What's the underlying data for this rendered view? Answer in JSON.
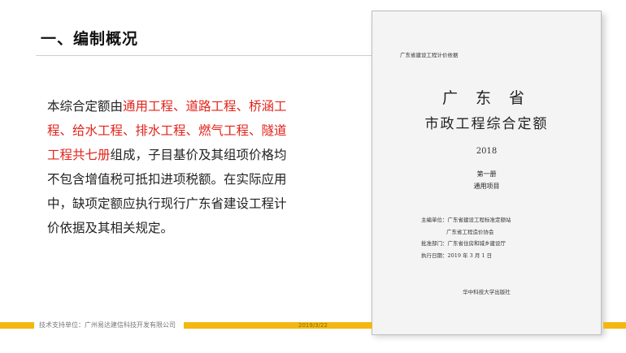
{
  "slide": {
    "title": "一、编制概况",
    "body": {
      "part1": "本综合定额由",
      "highlight1": "通用工程、道路工程、桥涵工程、给水工程、排水工程、燃气工程、隧道工程共七册",
      "part2": "组成，子目基价及其组项价格均不包含增值税可抵扣进项税额。在实际应用中，缺项定额应执行现行广东省建设工程计价依据及其相关规定。"
    }
  },
  "footer": {
    "company": "技术支持单位：广州易达建信科技开发有限公司",
    "date": "2019/3/22",
    "accent_color": "#f2b811"
  },
  "book_cover": {
    "series": "广东省建设工程计价依据",
    "province": "广 东 省",
    "title": "市政工程综合定额",
    "year": "2018",
    "volume": "第一册",
    "volume_name": "通用项目",
    "info": {
      "editor_line1": "主编单位：广东省建设工程标准定额站",
      "editor_line2": "广东省工程造价协会",
      "approver": "批准部门：广东省住房和城乡建设厅",
      "effective_date": "执行日期：2019 年 3 月 1 日"
    },
    "publisher": "华中科技大学出版社"
  },
  "colors": {
    "highlight": "#e2231a",
    "text": "#222222"
  }
}
